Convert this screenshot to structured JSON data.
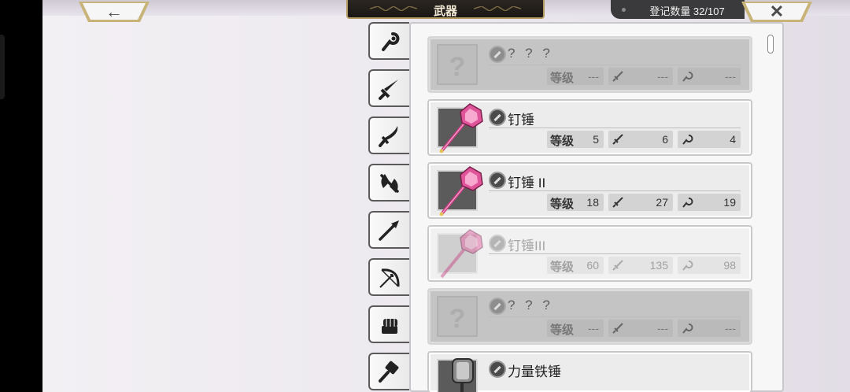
{
  "header": {
    "title": "武器",
    "register_count": "登记数量 32/107",
    "back_glyph": "←",
    "close_glyph": "✕"
  },
  "tabs": [
    {
      "icon": "staff-icon"
    },
    {
      "icon": "sword-icon"
    },
    {
      "icon": "curved-sword-icon"
    },
    {
      "icon": "axe-icon"
    },
    {
      "icon": "spear-icon"
    },
    {
      "icon": "bow-icon"
    },
    {
      "icon": "gauntlet-icon"
    },
    {
      "icon": "hammer-icon"
    }
  ],
  "list": {
    "level_label": "等级",
    "items": [
      {
        "name": "? ? ?",
        "state": "locked",
        "level": "---",
        "atk": "---",
        "mag": "---"
      },
      {
        "name": "钉锤",
        "state": "normal",
        "level": "5",
        "atk": "6",
        "mag": "4"
      },
      {
        "name": "钉锤 II",
        "state": "normal",
        "level": "18",
        "atk": "27",
        "mag": "19"
      },
      {
        "name": "钉锤III",
        "state": "dim",
        "level": "60",
        "atk": "135",
        "mag": "98"
      },
      {
        "name": "? ? ?",
        "state": "locked",
        "level": "---",
        "atk": "---",
        "mag": "---"
      },
      {
        "name": "力量铁锤",
        "state": "normal",
        "level": "",
        "atk": "",
        "mag": ""
      }
    ]
  },
  "colors": {
    "accent_gold": "#b39a5e",
    "mace_pink": "#e0559a"
  }
}
